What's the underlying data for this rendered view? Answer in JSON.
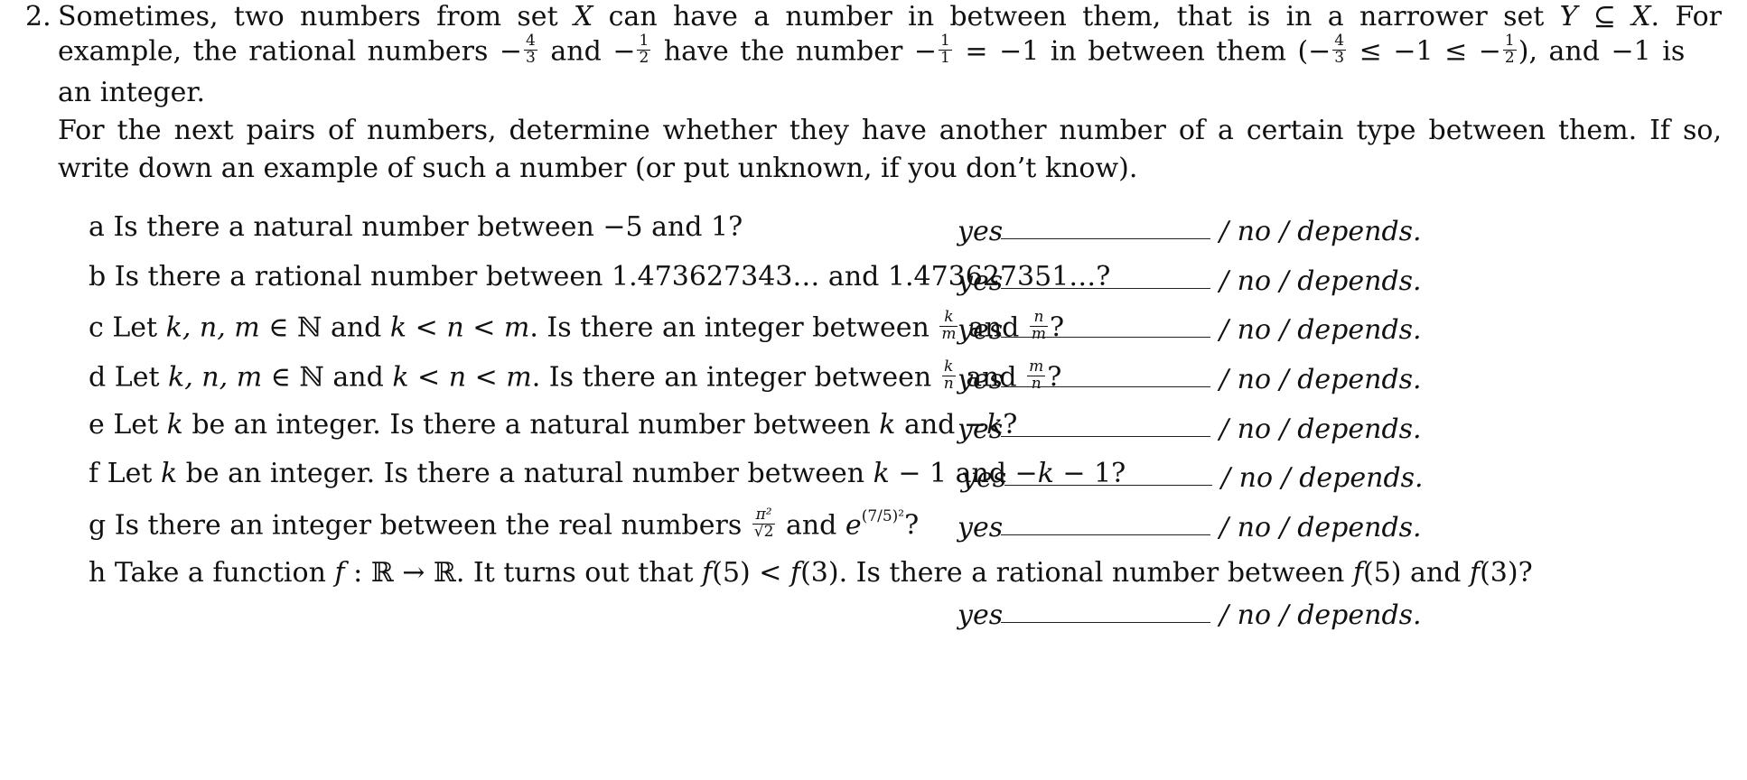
{
  "problem": {
    "number": "2.",
    "intro_line1": [
      "Sometimes, two numbers from set ",
      "X",
      " can have a number in between them, that is in a narrower set ",
      "Y",
      " ⊆ ",
      "X",
      ".  For"
    ],
    "intro_line2": {
      "t1": "example, the rational numbers −",
      "f1": {
        "num": "4",
        "den": "3"
      },
      "t2": " and −",
      "f2": {
        "num": "1",
        "den": "2"
      },
      "t3": " have the number −",
      "f3": {
        "num": "1",
        "den": "1"
      },
      "t4": " = −1 in between them (−",
      "f4": {
        "num": "4",
        "den": "3"
      },
      "t5": " ≤ −1 ≤ −",
      "f5": {
        "num": "1",
        "den": "2"
      },
      "t6": "), and −1 is"
    },
    "intro_line3": "an integer.",
    "instruction_line1": "For the next pairs of numbers, determine whether they have another number of a certain type between them.  If so,",
    "instruction_line2": "write down an example of such a number (or put unknown, if you don’t know)."
  },
  "answer_template": {
    "yes": "yes",
    "rest": "/ no / depends."
  },
  "questions": [
    {
      "label": "a",
      "text": "Is there a natural number between −5 and 1?"
    },
    {
      "label": "b",
      "text": "Is there a rational number between 1.473627343… and 1.473627351…?"
    },
    {
      "label": "c",
      "t1": "Let ",
      "v1": "k, n, m",
      "t2": " ∈ ℕ and ",
      "v2": "k",
      "t3": " < ",
      "v3": "n",
      "t4": " < ",
      "v4": "m",
      "t5": ". Is there an integer between ",
      "f1": {
        "num": "k",
        "den": "m"
      },
      "t6": " and ",
      "f2": {
        "num": "n",
        "den": "m"
      },
      "t7": "?"
    },
    {
      "label": "d",
      "t1": "Let ",
      "v1": "k, n, m",
      "t2": " ∈ ℕ and ",
      "v2": "k",
      "t3": " < ",
      "v3": "n",
      "t4": " < ",
      "v4": "m",
      "t5": ". Is there an integer between ",
      "f1": {
        "num": "k",
        "den": "n"
      },
      "t6": " and ",
      "f2": {
        "num": "m",
        "den": "n"
      },
      "t7": "?"
    },
    {
      "label": "e",
      "t1": "Let ",
      "v1": "k",
      "t2": " be an integer. Is there a natural number between ",
      "v2": "k",
      "t3": " and −",
      "v3": "k",
      "t4": "?"
    },
    {
      "label": "f",
      "t1": "Let ",
      "v1": "k",
      "t2": " be an integer. Is there a natural number between ",
      "v2": "k",
      "t3": " − 1 and −",
      "v3": "k",
      "t4": " − 1?"
    },
    {
      "label": "g",
      "t1": "Is there an integer between the real numbers ",
      "f1": {
        "num": "π²",
        "den": "√2"
      },
      "t2": " and ",
      "v1": "e",
      "sup": "(7/5)²",
      "t3": "?"
    },
    {
      "label": "h",
      "t1": "Take a function ",
      "v1": "f",
      "t2": " : ℝ → ℝ. It turns out that ",
      "v2": "f",
      "t3": "(5) < ",
      "v3": "f",
      "t4": "(3). Is there a rational number between ",
      "v4": "f",
      "t5": "(5) and ",
      "v5": "f",
      "t6": "(3)?"
    }
  ]
}
